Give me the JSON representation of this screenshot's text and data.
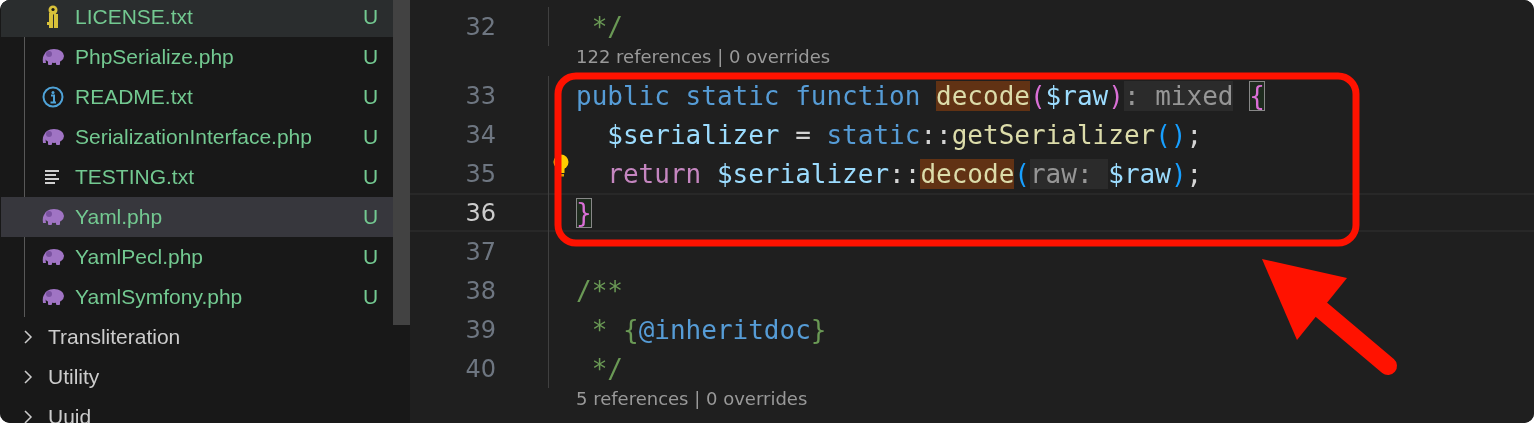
{
  "explorer": {
    "files": [
      {
        "name": "LICENSE.txt",
        "kind": "license",
        "status": "U",
        "hovered": true,
        "selected": false
      },
      {
        "name": "PhpSerialize.php",
        "kind": "php",
        "status": "U",
        "hovered": false,
        "selected": false
      },
      {
        "name": "README.txt",
        "kind": "info",
        "status": "U",
        "hovered": false,
        "selected": false
      },
      {
        "name": "SerializationInterface.php",
        "kind": "php",
        "status": "U",
        "hovered": false,
        "selected": false
      },
      {
        "name": "TESTING.txt",
        "kind": "text",
        "status": "U",
        "hovered": false,
        "selected": false
      },
      {
        "name": "Yaml.php",
        "kind": "php",
        "status": "U",
        "hovered": false,
        "selected": true
      },
      {
        "name": "YamlPecl.php",
        "kind": "php",
        "status": "U",
        "hovered": false,
        "selected": false
      },
      {
        "name": "YamlSymfony.php",
        "kind": "php",
        "status": "U",
        "hovered": false,
        "selected": false
      }
    ],
    "folders": [
      {
        "name": "Transliteration",
        "expanded": false
      },
      {
        "name": "Utility",
        "expanded": false
      },
      {
        "name": "Uuid",
        "expanded": false
      }
    ]
  },
  "editor": {
    "rows": [
      {
        "kind": "code",
        "number": "32",
        "active": false,
        "lightbulb": false,
        "tokens": [
          {
            "t": " */",
            "kind": "cmt"
          }
        ]
      },
      {
        "kind": "codelens",
        "text": "122 references | 0 overrides"
      },
      {
        "kind": "code",
        "number": "33",
        "active": false,
        "lightbulb": false,
        "tokens": [
          {
            "t": "public static function ",
            "kind": "kw"
          },
          {
            "t": "decode",
            "kind": "occ"
          },
          {
            "t": "(",
            "kind": "br1"
          },
          {
            "t": "$raw",
            "kind": "var"
          },
          {
            "t": ")",
            "kind": "br1"
          },
          {
            "t": ": mixed",
            "kind": "hint"
          },
          {
            "t": " {",
            "kind": "pair"
          }
        ]
      },
      {
        "kind": "code",
        "number": "34",
        "active": false,
        "lightbulb": false,
        "tokens": [
          {
            "t": "  $serializer",
            "kind": "var"
          },
          {
            "t": " = ",
            "kind": "op"
          },
          {
            "t": "static",
            "kind": "kw"
          },
          {
            "t": "::",
            "kind": "op"
          },
          {
            "t": "getSerializer",
            "kind": "fn"
          },
          {
            "t": "()",
            "kind": "br2"
          },
          {
            "t": ";",
            "kind": "op"
          }
        ]
      },
      {
        "kind": "code",
        "number": "35",
        "active": false,
        "lightbulb": true,
        "tokens": [
          {
            "t": "  return ",
            "kind": "ctl"
          },
          {
            "t": "$serializer",
            "kind": "var"
          },
          {
            "t": "::",
            "kind": "op"
          },
          {
            "t": "decode",
            "kind": "occ"
          },
          {
            "t": "(",
            "kind": "br2"
          },
          {
            "t": "raw: ",
            "kind": "hint"
          },
          {
            "t": "$raw",
            "kind": "var"
          },
          {
            "t": ")",
            "kind": "br2"
          },
          {
            "t": ";",
            "kind": "op"
          }
        ]
      },
      {
        "kind": "code",
        "number": "36",
        "active": true,
        "lightbulb": false,
        "tokens": [
          {
            "t": "}",
            "kind": "pair"
          }
        ]
      },
      {
        "kind": "code",
        "number": "37",
        "active": false,
        "lightbulb": false
      },
      {
        "kind": "code",
        "number": "38",
        "active": false,
        "lightbulb": false,
        "tokens": [
          {
            "t": "/**",
            "kind": "cmt"
          }
        ]
      },
      {
        "kind": "code",
        "number": "39",
        "active": false,
        "lightbulb": false,
        "tokens": [
          {
            "t": " * {",
            "kind": "cmt"
          },
          {
            "t": "@inheritdoc",
            "kind": "doc"
          },
          {
            "t": "}",
            "kind": "cmt"
          }
        ]
      },
      {
        "kind": "code",
        "number": "40",
        "active": false,
        "lightbulb": false,
        "tokens": [
          {
            "t": " */",
            "kind": "cmt"
          }
        ]
      },
      {
        "kind": "codelens",
        "text": "5 references | 0 overrides"
      }
    ]
  }
}
